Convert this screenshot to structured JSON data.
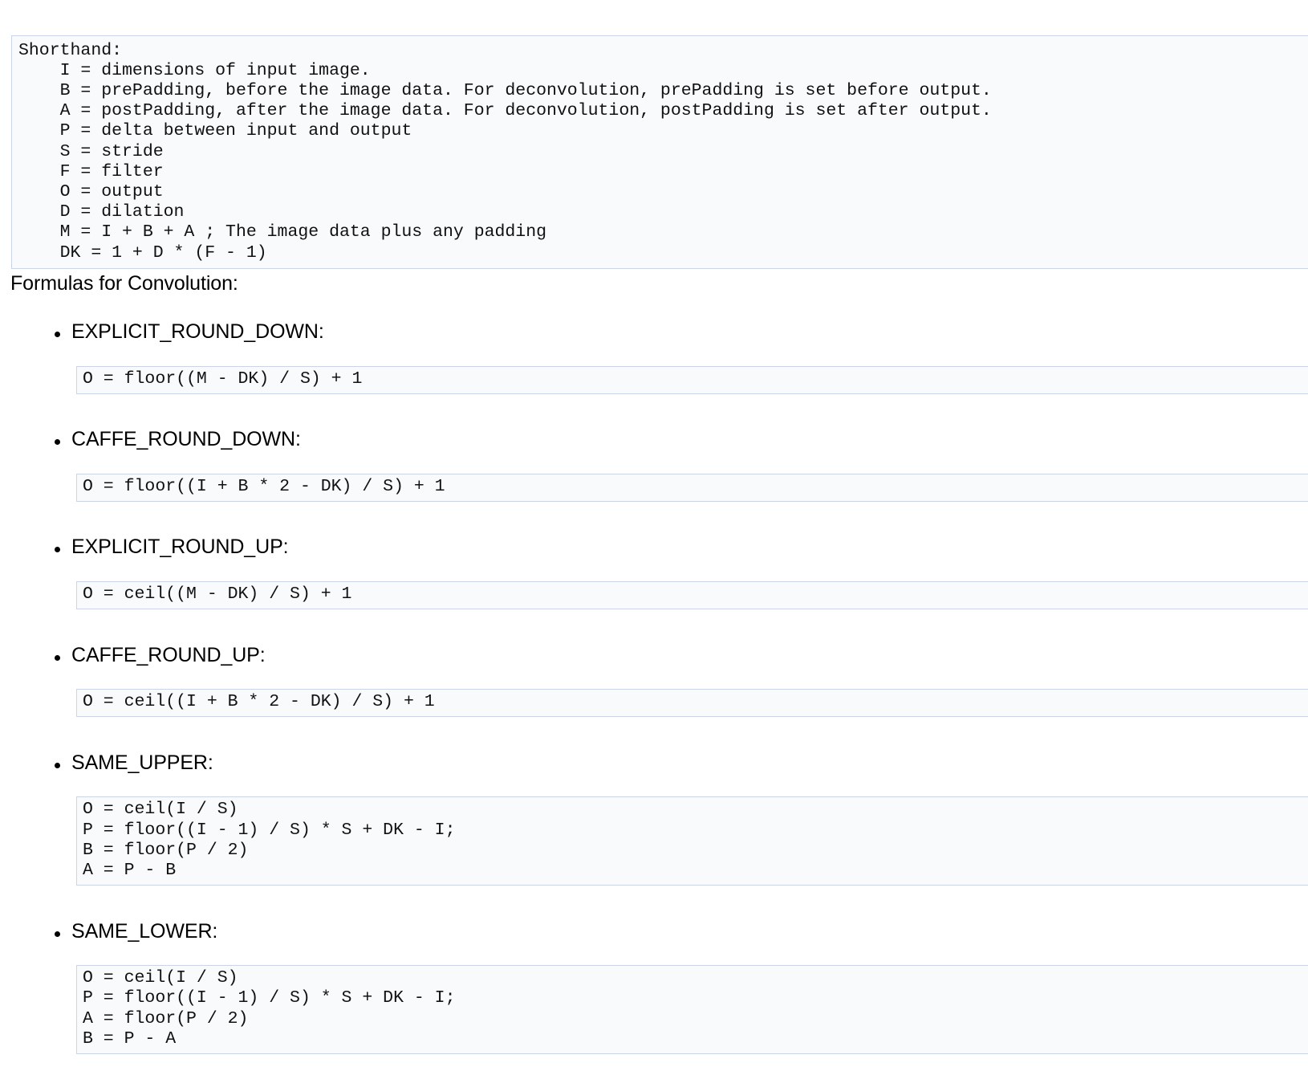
{
  "shorthand": {
    "title": "Shorthand:",
    "lines": [
      "Shorthand:",
      "    I = dimensions of input image.",
      "    B = prePadding, before the image data. For deconvolution, prePadding is set before output.",
      "    A = postPadding, after the image data. For deconvolution, postPadding is set after output.",
      "    P = delta between input and output",
      "    S = stride",
      "    F = filter",
      "    O = output",
      "    D = dilation",
      "    M = I + B + A ; The image data plus any padding",
      "    DK = 1 + D * (F - 1)"
    ],
    "text": "Shorthand:\n    I = dimensions of input image.\n    B = prePadding, before the image data. For deconvolution, prePadding is set before output.\n    A = postPadding, after the image data. For deconvolution, postPadding is set after output.\n    P = delta between input and output\n    S = stride\n    F = filter\n    O = output\n    D = dilation\n    M = I + B + A ; The image data plus any padding\n    DK = 1 + D * (F - 1)"
  },
  "section": {
    "heading": "Formulas for Convolution:"
  },
  "formulas": [
    {
      "label": "EXPLICIT_ROUND_DOWN:",
      "code": "O = floor((M - DK) / S) + 1"
    },
    {
      "label": "CAFFE_ROUND_DOWN:",
      "code": "O = floor((I + B * 2 - DK) / S) + 1"
    },
    {
      "label": "EXPLICIT_ROUND_UP:",
      "code": "O = ceil((M - DK) / S) + 1"
    },
    {
      "label": "CAFFE_ROUND_UP:",
      "code": "O = ceil((I + B * 2 - DK) / S) + 1"
    },
    {
      "label": "SAME_UPPER:",
      "code": "O = ceil(I / S)\nP = floor((I - 1) / S) * S + DK - I;\nB = floor(P / 2)\nA = P - B"
    },
    {
      "label": "SAME_LOWER:",
      "code": "O = ceil(I / S)\nP = floor((I - 1) / S) * S + DK - I;\nA = floor(P / 2)\nB = P - A"
    }
  ],
  "colors": {
    "code_background": "#f8fafc",
    "code_border": "#ccd4e8",
    "page_background": "#ffffff",
    "text": "#000000"
  }
}
